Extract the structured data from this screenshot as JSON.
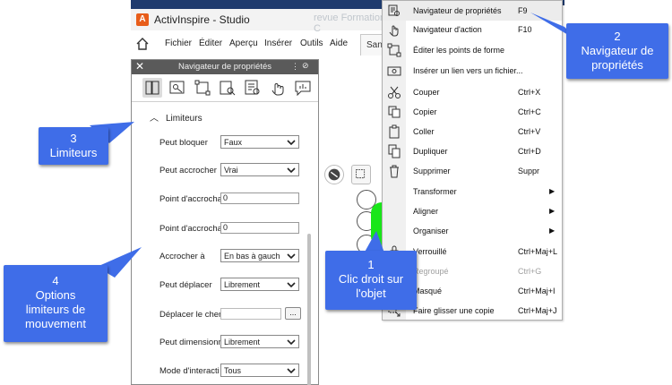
{
  "app": {
    "title": "ActivInspire - Studio",
    "ghost_title": "revue Formation C",
    "app_icon_text": "A",
    "menu": [
      "Fichier",
      "Éditer",
      "Aperçu",
      "Insérer",
      "Outils",
      "Aide"
    ],
    "doc_tab_label": "Sans"
  },
  "panel": {
    "title": "Navigateur de propriétés",
    "close_glyph": "✕",
    "menu_glyph": "⋮",
    "pin_glyph": "⊘",
    "section_title": "Limiteurs",
    "rows": [
      {
        "label": "Peut bloquer",
        "type": "dropdown",
        "value": "Faux"
      },
      {
        "label": "Peut accrocher",
        "type": "dropdown",
        "value": "Vrai"
      },
      {
        "label": "Point d'accrocha",
        "type": "text",
        "value": "0"
      },
      {
        "label": "Point d'accrocha",
        "type": "text",
        "value": "0"
      },
      {
        "label": "Accrocher à",
        "type": "dropdown",
        "value": "En bas à gauch"
      },
      {
        "label": "Peut déplacer",
        "type": "dropdown",
        "value": "Librement"
      },
      {
        "label": "Déplacer le chem",
        "type": "path",
        "value": "",
        "button": "..."
      },
      {
        "label": "Peut dimensionn",
        "type": "dropdown",
        "value": "Librement"
      },
      {
        "label": "Mode d'interacti",
        "type": "dropdown",
        "value": "Tous"
      }
    ]
  },
  "context_menu": {
    "items": [
      {
        "label": "Navigateur de propriétés",
        "shortcut": "F9",
        "icon": "property-browser-icon"
      },
      {
        "label": "Navigateur d'action",
        "shortcut": "F10",
        "icon": "action-browser-icon"
      },
      {
        "label": "Éditer les points de forme",
        "shortcut": "",
        "icon": "edit-shape-points-icon"
      },
      {
        "label": "Insérer un lien vers un fichier...",
        "shortcut": "",
        "icon": "insert-file-link-icon"
      },
      {
        "label": "Couper",
        "shortcut": "Ctrl+X",
        "icon": "scissors-icon"
      },
      {
        "label": "Copier",
        "shortcut": "Ctrl+C",
        "icon": "copy-icon"
      },
      {
        "label": "Coller",
        "shortcut": "Ctrl+V",
        "icon": "paste-icon"
      },
      {
        "label": "Dupliquer",
        "shortcut": "Ctrl+D",
        "icon": "duplicate-icon"
      },
      {
        "label": "Supprimer",
        "shortcut": "Suppr",
        "icon": "trash-icon"
      },
      {
        "label": "Transformer",
        "shortcut": "",
        "submenu": "▶",
        "icon": ""
      },
      {
        "label": "Aligner",
        "shortcut": "",
        "submenu": "▶",
        "icon": ""
      },
      {
        "label": "Organiser",
        "shortcut": "",
        "submenu": "▶",
        "icon": ""
      },
      {
        "label": "Verrouillé",
        "shortcut": "Ctrl+Maj+L",
        "icon": "lock-icon"
      },
      {
        "label": "Regroupé",
        "shortcut": "Ctrl+G",
        "icon": "group-icon",
        "disabled": true
      },
      {
        "label": "Masqué",
        "shortcut": "Ctrl+Maj+I",
        "icon": "hide-icon"
      },
      {
        "label": "Faire glisser une copie",
        "shortcut": "Ctrl+Maj+J",
        "icon": "drag-copy-icon"
      }
    ]
  },
  "callouts": {
    "c1": {
      "num": "1",
      "lines": [
        "Clic droit sur",
        "l'objet"
      ]
    },
    "c2": {
      "num": "2",
      "lines": [
        "Navigateur de",
        "propriétés"
      ]
    },
    "c3": {
      "num": "3",
      "lines": [
        "Limiteurs"
      ]
    },
    "c4": {
      "num": "4",
      "lines": [
        "Options",
        "limiteurs de",
        "mouvement"
      ]
    }
  },
  "colors": {
    "callout_blue": "#3f6de8",
    "green_object": "#19e619",
    "panel_header": "#5a5a5a"
  }
}
